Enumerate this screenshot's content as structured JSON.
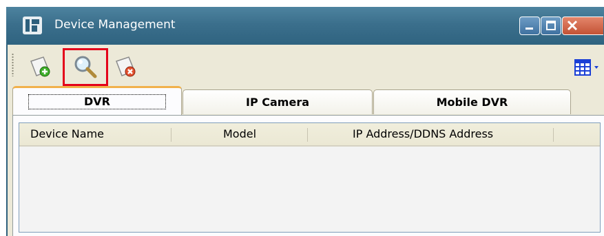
{
  "window": {
    "title": "Device Management"
  },
  "toolbar": {
    "buttons": [
      {
        "name": "add-device",
        "icon": "add-icon"
      },
      {
        "name": "search-device",
        "icon": "search-icon",
        "highlighted": true
      },
      {
        "name": "delete-device",
        "icon": "delete-icon"
      }
    ],
    "view_icon": "grid-view-icon"
  },
  "tabs": [
    {
      "label": "DVR",
      "active": true
    },
    {
      "label": "IP Camera",
      "active": false
    },
    {
      "label": "Mobile DVR",
      "active": false
    }
  ],
  "table": {
    "columns": [
      "Device Name",
      "Model",
      "IP Address/DDNS Address"
    ],
    "rows": []
  },
  "colors": {
    "title_bar": "#3b6f8c",
    "highlight": "#e4001a",
    "active_tab_accent": "#f1b14b",
    "client_bg": "#ece9d8"
  }
}
